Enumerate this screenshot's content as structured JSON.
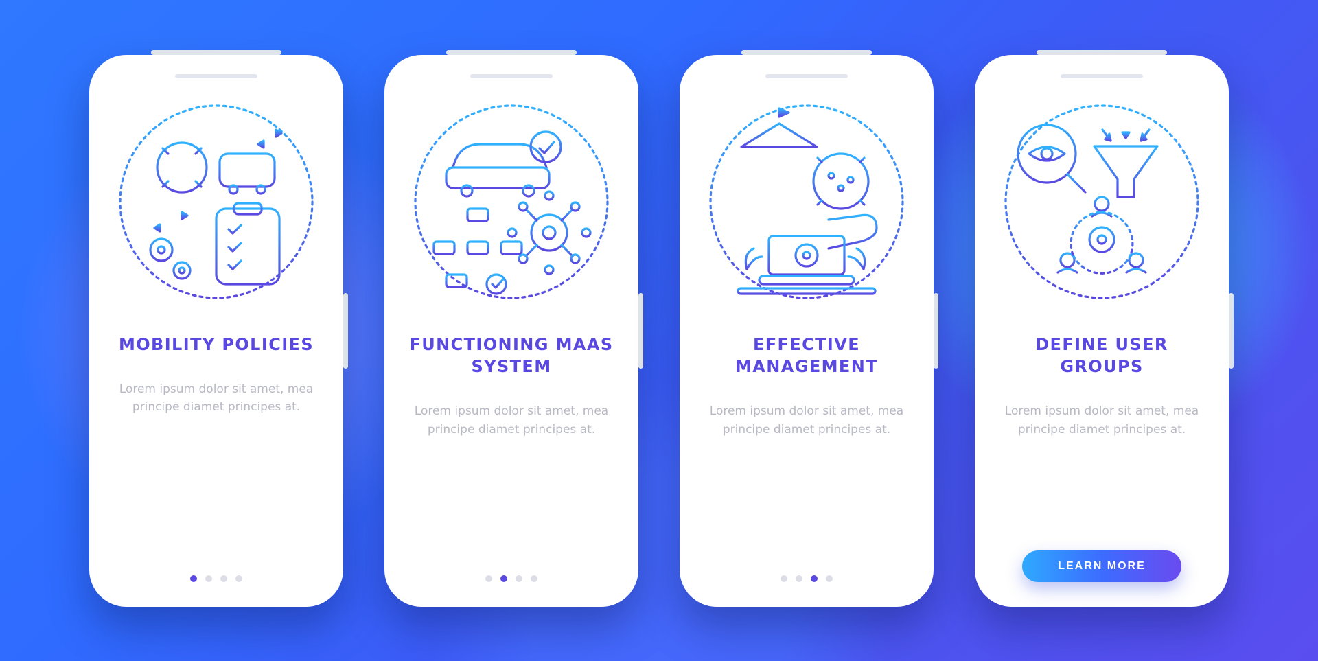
{
  "common": {
    "description": "Lorem ipsum dolor sit amet, mea principe diamet principes at.",
    "cta_label": "LEARN MORE"
  },
  "screens": [
    {
      "title": "MOBILITY POLICIES",
      "icon": "mobility-policies-icon",
      "active_index": 0,
      "has_cta": false
    },
    {
      "title": "FUNCTIONING MAAS SYSTEM",
      "icon": "functioning-maas-icon",
      "active_index": 1,
      "has_cta": false
    },
    {
      "title": "EFFECTIVE MANAGEMENT",
      "icon": "effective-management-icon",
      "active_index": 2,
      "has_cta": false
    },
    {
      "title": "DEFINE USER GROUPS",
      "icon": "define-user-groups-icon",
      "active_index": 3,
      "has_cta": true
    }
  ],
  "colors": {
    "gradient_from": "#2fb2ff",
    "gradient_to": "#5a49e0",
    "accent": "#5a49e0",
    "muted": "#b8b9c4"
  }
}
